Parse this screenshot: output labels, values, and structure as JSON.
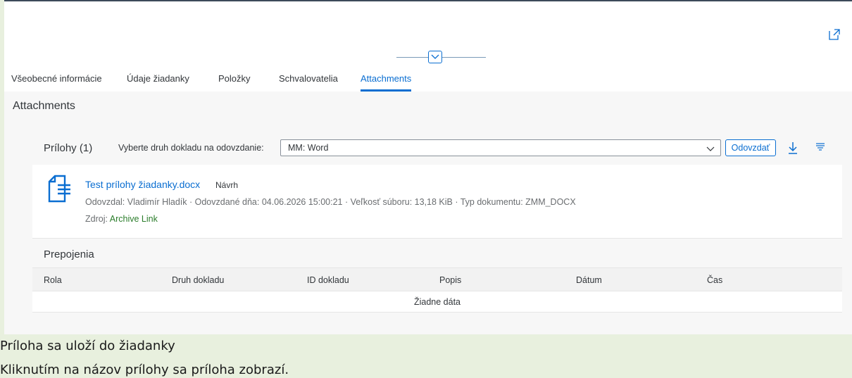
{
  "tabs": [
    {
      "label": "Všeobecné informácie"
    },
    {
      "label": "Údaje žiadanky"
    },
    {
      "label": "Položky"
    },
    {
      "label": "Schvalovatelia"
    },
    {
      "label": "Attachments",
      "active": true
    }
  ],
  "section": {
    "title": "Attachments"
  },
  "toolbar": {
    "title": "Prílohy (1)",
    "select_label": "Vyberte druh dokladu na odovzdanie:",
    "select_value": "MM: Word",
    "upload_label": "Odovzdať"
  },
  "attachment": {
    "name": "Test prílohy žiadanky.docx",
    "status": "Návrh",
    "meta": "Odovzdal: Vladimír Hladík · Odovzdané dňa: 04.06.2026 15:00:21 · Veľkosť súboru: 13,18 KiB · Typ dokumentu: ZMM_DOCX",
    "source_label": "Zdroj:",
    "source_value": "Archive Link"
  },
  "links": {
    "title": "Prepojenia",
    "columns": [
      "Rola",
      "Druh dokladu",
      "ID dokladu",
      "Popis",
      "Dátum",
      "Čas"
    ],
    "empty_text": "Žiadne dáta"
  },
  "note": {
    "line1": "Príloha sa uloží do žiadanky",
    "line2": "Kliknutím na názov prílohy sa príloha zobrazí."
  },
  "colors": {
    "accent": "#0a6ed1",
    "source_link": "#2b7d2b",
    "note_background": "#e8f0de"
  },
  "icons": [
    "share-icon",
    "chevron-down-icon",
    "document-icon",
    "download-icon",
    "filter-icon"
  ]
}
